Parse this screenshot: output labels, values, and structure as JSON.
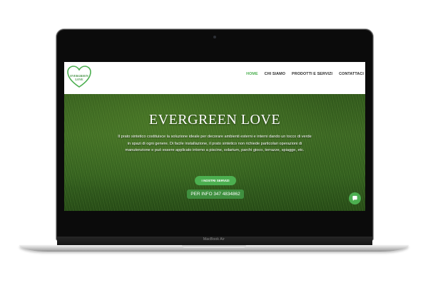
{
  "device": {
    "label": "MacBook Air"
  },
  "header": {
    "logo_text": "EVERGREEN LOVE",
    "nav": [
      {
        "label": "HOME",
        "active": true
      },
      {
        "label": "CHI SIAMO",
        "active": false
      },
      {
        "label": "PRODOTTI E SERVIZI",
        "active": false
      },
      {
        "label": "CONTATTACI",
        "active": false
      }
    ]
  },
  "hero": {
    "title": "EVERGREEN LOVE",
    "text": "Il prato sintetico costituisce la soluzione ideale per decorare ambienti esterni e interni dando un tocco di verde in spazi di ogni genere. Di facile installazione, il prato sintetico non richiede particolari operazioni di manutenzione e può essere applicato intorno a piscine, solarium, parchi gioco, terrazze, spiagge, etc.",
    "primary_button": "I NOSTRI SERVIZI",
    "info_button": "PER INFO 347 4834862"
  },
  "colors": {
    "accent": "#4caf50",
    "nav_text": "#2a2a2a",
    "hero_text": "#ffffff"
  },
  "icons": {
    "logo": "heart-logo-icon",
    "chat": "chat-bubble-icon"
  }
}
